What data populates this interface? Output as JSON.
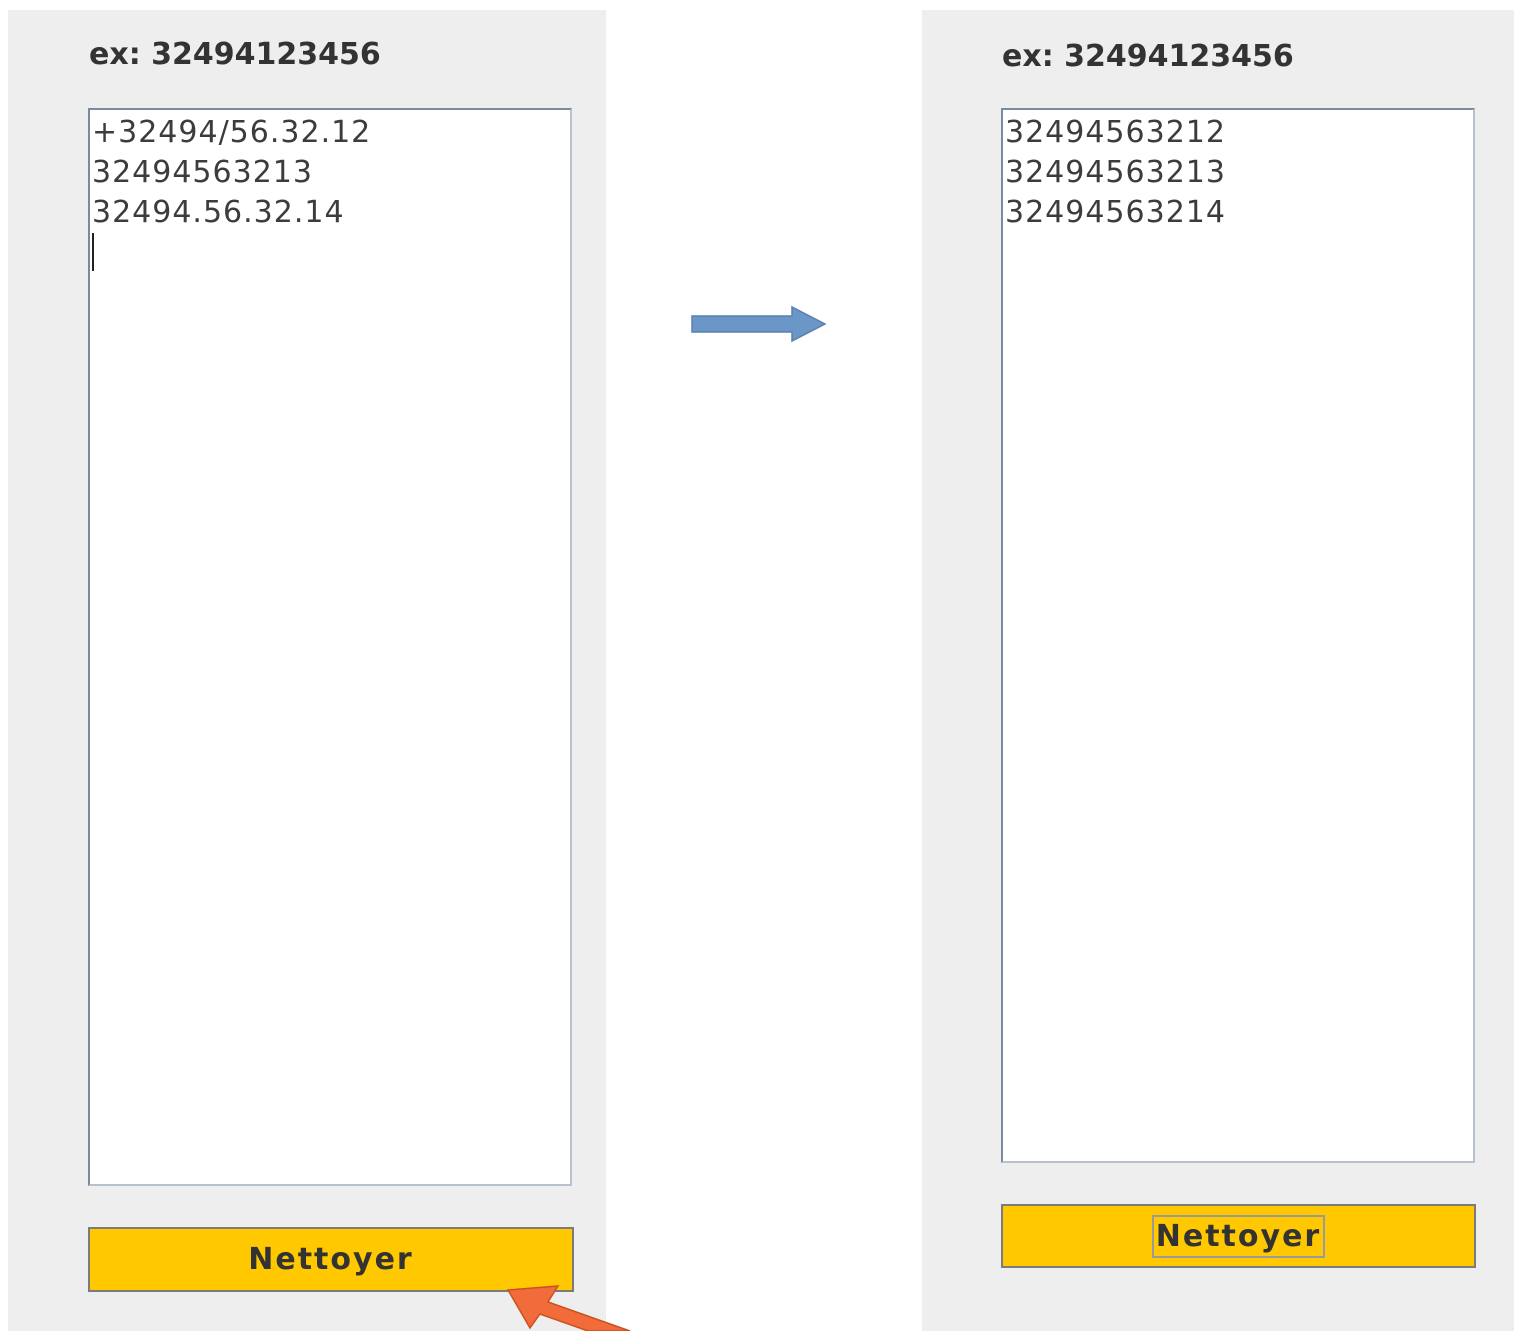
{
  "before": {
    "hint": "ex: 32494123456",
    "textarea_lines": [
      "+32494/56.32.12",
      "32494563213",
      "32494.56.32.14"
    ],
    "button_label": "Nettoyer"
  },
  "after": {
    "hint": "ex: 32494123456",
    "textarea_lines": [
      "32494563212",
      "32494563213",
      "32494563214"
    ],
    "button_label": "Nettoyer"
  },
  "colors": {
    "panel_bg": "#eeeeee",
    "button_bg": "#ffc800",
    "transition_arrow": "#6a96c8",
    "pointer_arrow": "#f26b3a"
  },
  "icons": {
    "transition": "right-arrow-icon",
    "pointer": "pointer-arrow-icon"
  }
}
